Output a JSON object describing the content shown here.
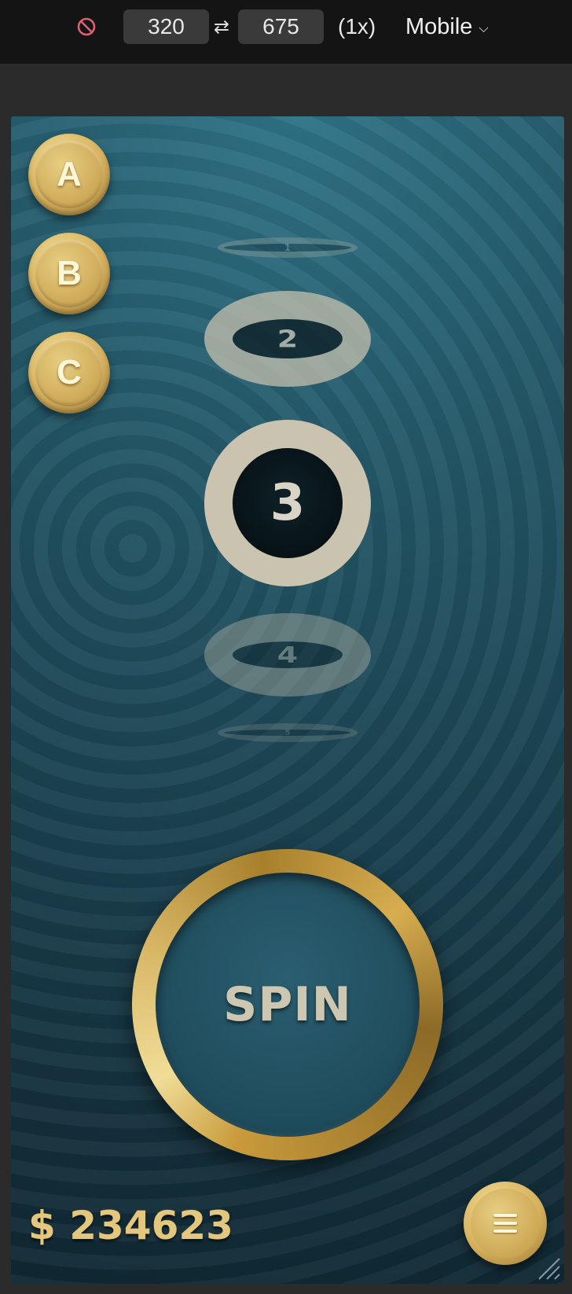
{
  "toolbar": {
    "width": "320",
    "height": "675",
    "swap_symbol": "⇄",
    "dpr": "(1x)",
    "device": "Mobile",
    "icons": [
      "no-throttle-icon",
      "swap-icon",
      "chevron-down-icon"
    ]
  },
  "game": {
    "side_buttons": [
      "A",
      "B",
      "C"
    ],
    "reel": [
      "1",
      "2",
      "3",
      "4",
      "5"
    ],
    "selected_reel_value": "3",
    "spin_label": "SPIN",
    "balance": "$ 234623",
    "menu_icon": "menu-icon",
    "colors": {
      "gold": "#d7b25e",
      "background": "#1b4352",
      "ring": "#cac3b0"
    }
  }
}
